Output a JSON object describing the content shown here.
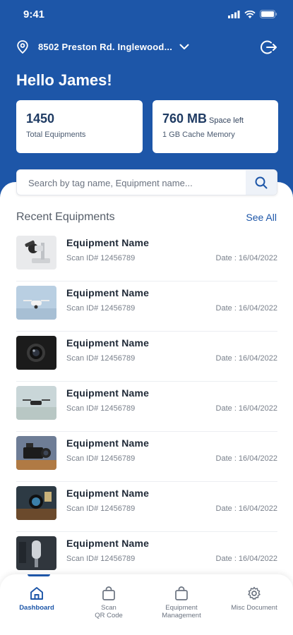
{
  "status": {
    "time": "9:41"
  },
  "header": {
    "location": "8502 Preston Rd. Inglewood...",
    "greeting": "Hello James!"
  },
  "stats": {
    "equipments_count": "1450",
    "equipments_label": "Total Equipments",
    "space_value": "760 MB",
    "space_suffix": "Space left",
    "cache_label": "1 GB Cache Memory"
  },
  "search": {
    "placeholder": "Search by tag name, Equipment name..."
  },
  "recent": {
    "title": "Recent Equipments",
    "see_all": "See All",
    "items": [
      {
        "name": "Equipment Name",
        "scan": "Scan ID# 12456789",
        "date": "Date : 16/04/2022",
        "thumb": "microscope"
      },
      {
        "name": "Equipment Name",
        "scan": "Scan ID# 12456789",
        "date": "Date : 16/04/2022",
        "thumb": "drone-sky"
      },
      {
        "name": "Equipment Name",
        "scan": "Scan ID# 12456789",
        "date": "Date : 16/04/2022",
        "thumb": "camera-lens"
      },
      {
        "name": "Equipment Name",
        "scan": "Scan ID# 12456789",
        "date": "Date : 16/04/2022",
        "thumb": "drone-flying"
      },
      {
        "name": "Equipment Name",
        "scan": "Scan ID# 12456789",
        "date": "Date : 16/04/2022",
        "thumb": "video-camera"
      },
      {
        "name": "Equipment Name",
        "scan": "Scan ID# 12456789",
        "date": "Date : 16/04/2022",
        "thumb": "camera-desk"
      },
      {
        "name": "Equipment Name",
        "scan": "Scan ID# 12456789",
        "date": "Date : 16/04/2022",
        "thumb": "microphone"
      }
    ]
  },
  "tabs": [
    {
      "label": "Dashboard",
      "icon": "home-icon",
      "active": true
    },
    {
      "label": "Scan\nQR Code",
      "icon": "bag-icon",
      "active": false
    },
    {
      "label": "Equipment\nManagement",
      "icon": "bag-icon",
      "active": false
    },
    {
      "label": "Misc Document",
      "icon": "gear-icon",
      "active": false
    }
  ],
  "colors": {
    "primary": "#1d56a8",
    "text_dark": "#1f2937",
    "text_muted": "#7a818c"
  }
}
